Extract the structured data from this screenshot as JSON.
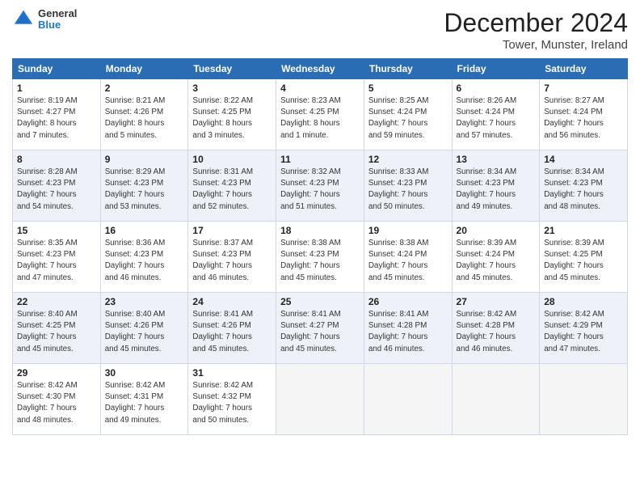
{
  "header": {
    "logo_general": "General",
    "logo_blue": "Blue",
    "month_title": "December 2024",
    "location": "Tower, Munster, Ireland"
  },
  "days_of_week": [
    "Sunday",
    "Monday",
    "Tuesday",
    "Wednesday",
    "Thursday",
    "Friday",
    "Saturday"
  ],
  "weeks": [
    [
      {
        "day": "1",
        "detail": "Sunrise: 8:19 AM\nSunset: 4:27 PM\nDaylight: 8 hours\nand 7 minutes."
      },
      {
        "day": "2",
        "detail": "Sunrise: 8:21 AM\nSunset: 4:26 PM\nDaylight: 8 hours\nand 5 minutes."
      },
      {
        "day": "3",
        "detail": "Sunrise: 8:22 AM\nSunset: 4:25 PM\nDaylight: 8 hours\nand 3 minutes."
      },
      {
        "day": "4",
        "detail": "Sunrise: 8:23 AM\nSunset: 4:25 PM\nDaylight: 8 hours\nand 1 minute."
      },
      {
        "day": "5",
        "detail": "Sunrise: 8:25 AM\nSunset: 4:24 PM\nDaylight: 7 hours\nand 59 minutes."
      },
      {
        "day": "6",
        "detail": "Sunrise: 8:26 AM\nSunset: 4:24 PM\nDaylight: 7 hours\nand 57 minutes."
      },
      {
        "day": "7",
        "detail": "Sunrise: 8:27 AM\nSunset: 4:24 PM\nDaylight: 7 hours\nand 56 minutes."
      }
    ],
    [
      {
        "day": "8",
        "detail": "Sunrise: 8:28 AM\nSunset: 4:23 PM\nDaylight: 7 hours\nand 54 minutes."
      },
      {
        "day": "9",
        "detail": "Sunrise: 8:29 AM\nSunset: 4:23 PM\nDaylight: 7 hours\nand 53 minutes."
      },
      {
        "day": "10",
        "detail": "Sunrise: 8:31 AM\nSunset: 4:23 PM\nDaylight: 7 hours\nand 52 minutes."
      },
      {
        "day": "11",
        "detail": "Sunrise: 8:32 AM\nSunset: 4:23 PM\nDaylight: 7 hours\nand 51 minutes."
      },
      {
        "day": "12",
        "detail": "Sunrise: 8:33 AM\nSunset: 4:23 PM\nDaylight: 7 hours\nand 50 minutes."
      },
      {
        "day": "13",
        "detail": "Sunrise: 8:34 AM\nSunset: 4:23 PM\nDaylight: 7 hours\nand 49 minutes."
      },
      {
        "day": "14",
        "detail": "Sunrise: 8:34 AM\nSunset: 4:23 PM\nDaylight: 7 hours\nand 48 minutes."
      }
    ],
    [
      {
        "day": "15",
        "detail": "Sunrise: 8:35 AM\nSunset: 4:23 PM\nDaylight: 7 hours\nand 47 minutes."
      },
      {
        "day": "16",
        "detail": "Sunrise: 8:36 AM\nSunset: 4:23 PM\nDaylight: 7 hours\nand 46 minutes."
      },
      {
        "day": "17",
        "detail": "Sunrise: 8:37 AM\nSunset: 4:23 PM\nDaylight: 7 hours\nand 46 minutes."
      },
      {
        "day": "18",
        "detail": "Sunrise: 8:38 AM\nSunset: 4:23 PM\nDaylight: 7 hours\nand 45 minutes."
      },
      {
        "day": "19",
        "detail": "Sunrise: 8:38 AM\nSunset: 4:24 PM\nDaylight: 7 hours\nand 45 minutes."
      },
      {
        "day": "20",
        "detail": "Sunrise: 8:39 AM\nSunset: 4:24 PM\nDaylight: 7 hours\nand 45 minutes."
      },
      {
        "day": "21",
        "detail": "Sunrise: 8:39 AM\nSunset: 4:25 PM\nDaylight: 7 hours\nand 45 minutes."
      }
    ],
    [
      {
        "day": "22",
        "detail": "Sunrise: 8:40 AM\nSunset: 4:25 PM\nDaylight: 7 hours\nand 45 minutes."
      },
      {
        "day": "23",
        "detail": "Sunrise: 8:40 AM\nSunset: 4:26 PM\nDaylight: 7 hours\nand 45 minutes."
      },
      {
        "day": "24",
        "detail": "Sunrise: 8:41 AM\nSunset: 4:26 PM\nDaylight: 7 hours\nand 45 minutes."
      },
      {
        "day": "25",
        "detail": "Sunrise: 8:41 AM\nSunset: 4:27 PM\nDaylight: 7 hours\nand 45 minutes."
      },
      {
        "day": "26",
        "detail": "Sunrise: 8:41 AM\nSunset: 4:28 PM\nDaylight: 7 hours\nand 46 minutes."
      },
      {
        "day": "27",
        "detail": "Sunrise: 8:42 AM\nSunset: 4:28 PM\nDaylight: 7 hours\nand 46 minutes."
      },
      {
        "day": "28",
        "detail": "Sunrise: 8:42 AM\nSunset: 4:29 PM\nDaylight: 7 hours\nand 47 minutes."
      }
    ],
    [
      {
        "day": "29",
        "detail": "Sunrise: 8:42 AM\nSunset: 4:30 PM\nDaylight: 7 hours\nand 48 minutes."
      },
      {
        "day": "30",
        "detail": "Sunrise: 8:42 AM\nSunset: 4:31 PM\nDaylight: 7 hours\nand 49 minutes."
      },
      {
        "day": "31",
        "detail": "Sunrise: 8:42 AM\nSunset: 4:32 PM\nDaylight: 7 hours\nand 50 minutes."
      },
      {
        "day": "",
        "detail": ""
      },
      {
        "day": "",
        "detail": ""
      },
      {
        "day": "",
        "detail": ""
      },
      {
        "day": "",
        "detail": ""
      }
    ]
  ]
}
